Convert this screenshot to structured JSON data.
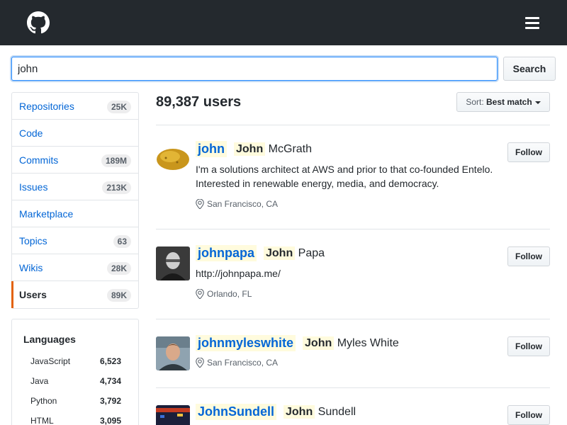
{
  "search": {
    "value": "john",
    "button": "Search"
  },
  "menu": [
    {
      "label": "Repositories",
      "count": "25K"
    },
    {
      "label": "Code",
      "count": ""
    },
    {
      "label": "Commits",
      "count": "189M"
    },
    {
      "label": "Issues",
      "count": "213K"
    },
    {
      "label": "Marketplace",
      "count": ""
    },
    {
      "label": "Topics",
      "count": "63"
    },
    {
      "label": "Wikis",
      "count": "28K"
    },
    {
      "label": "Users",
      "count": "89K"
    }
  ],
  "languages": {
    "title": "Languages",
    "items": [
      {
        "name": "JavaScript",
        "count": "6,523"
      },
      {
        "name": "Java",
        "count": "4,734"
      },
      {
        "name": "Python",
        "count": "3,792"
      },
      {
        "name": "HTML",
        "count": "3,095"
      }
    ]
  },
  "results": {
    "count_label": "89,387 users",
    "sort_prefix": "Sort:",
    "sort_value": "Best match"
  },
  "follow_label": "Follow",
  "users": [
    {
      "login": "john",
      "first": "John",
      "rest": "McGrath",
      "bio": "I'm a solutions architect at AWS and prior to that co-founded Entelo. Interested in renewable energy, media, and democracy.",
      "location": "San Francisco, CA"
    },
    {
      "login": "johnpapa",
      "first": "John",
      "rest": "Papa",
      "bio": "http://johnpapa.me/",
      "location": "Orlando, FL"
    },
    {
      "login": "johnmyleswhite",
      "first": "John",
      "rest": "Myles White",
      "bio": "",
      "location": "San Francisco, CA"
    },
    {
      "login": "JohnSundell",
      "first": "John",
      "rest": "Sundell",
      "bio": "",
      "location": ""
    }
  ]
}
